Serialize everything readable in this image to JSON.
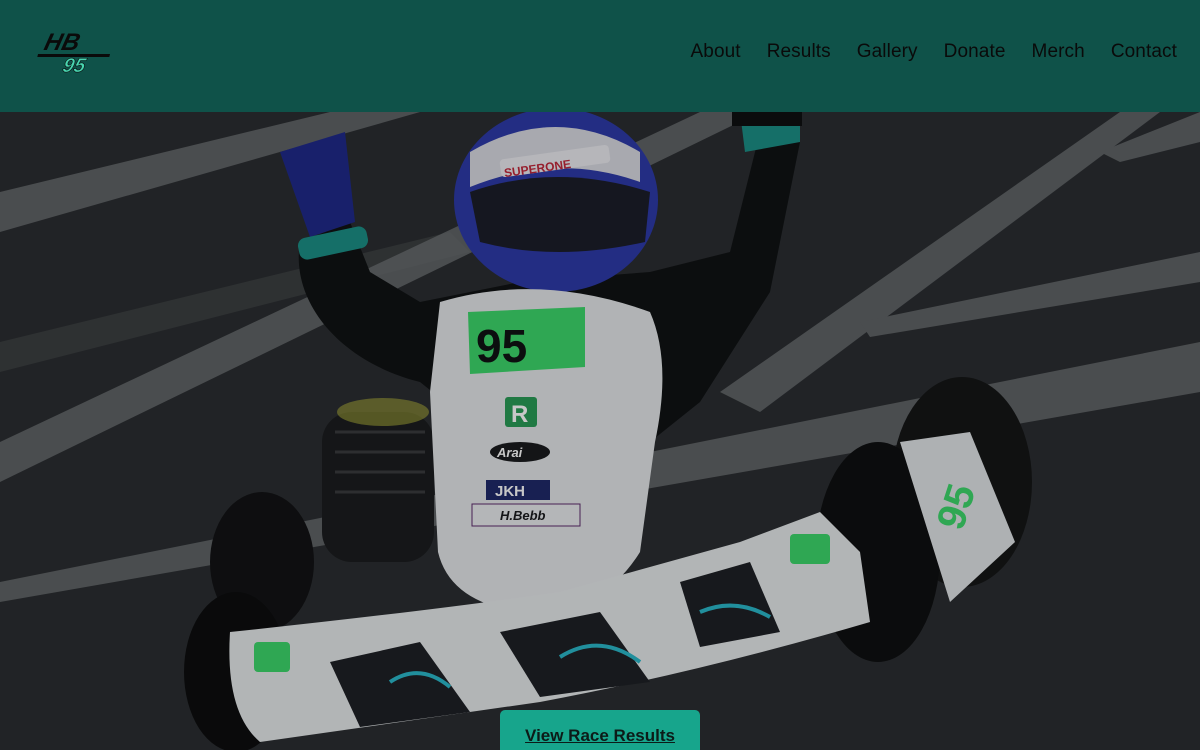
{
  "brand": {
    "logo_text": "HB",
    "logo_number": "95"
  },
  "nav": {
    "items": [
      {
        "label": "About"
      },
      {
        "label": "Results"
      },
      {
        "label": "Gallery"
      },
      {
        "label": "Donate"
      },
      {
        "label": "Merch"
      },
      {
        "label": "Contact"
      }
    ]
  },
  "hero": {
    "cta_label": "View Race Results",
    "kart_number": "95",
    "helmet_brand": "SUPERONE",
    "sponsors": [
      "Arai",
      "JKH",
      "H.Bebb",
      "R",
      "SUPERONE"
    ]
  },
  "colors": {
    "header_bg": "#0f5249",
    "accent": "#17a58c",
    "number_green": "#3dd66b"
  }
}
